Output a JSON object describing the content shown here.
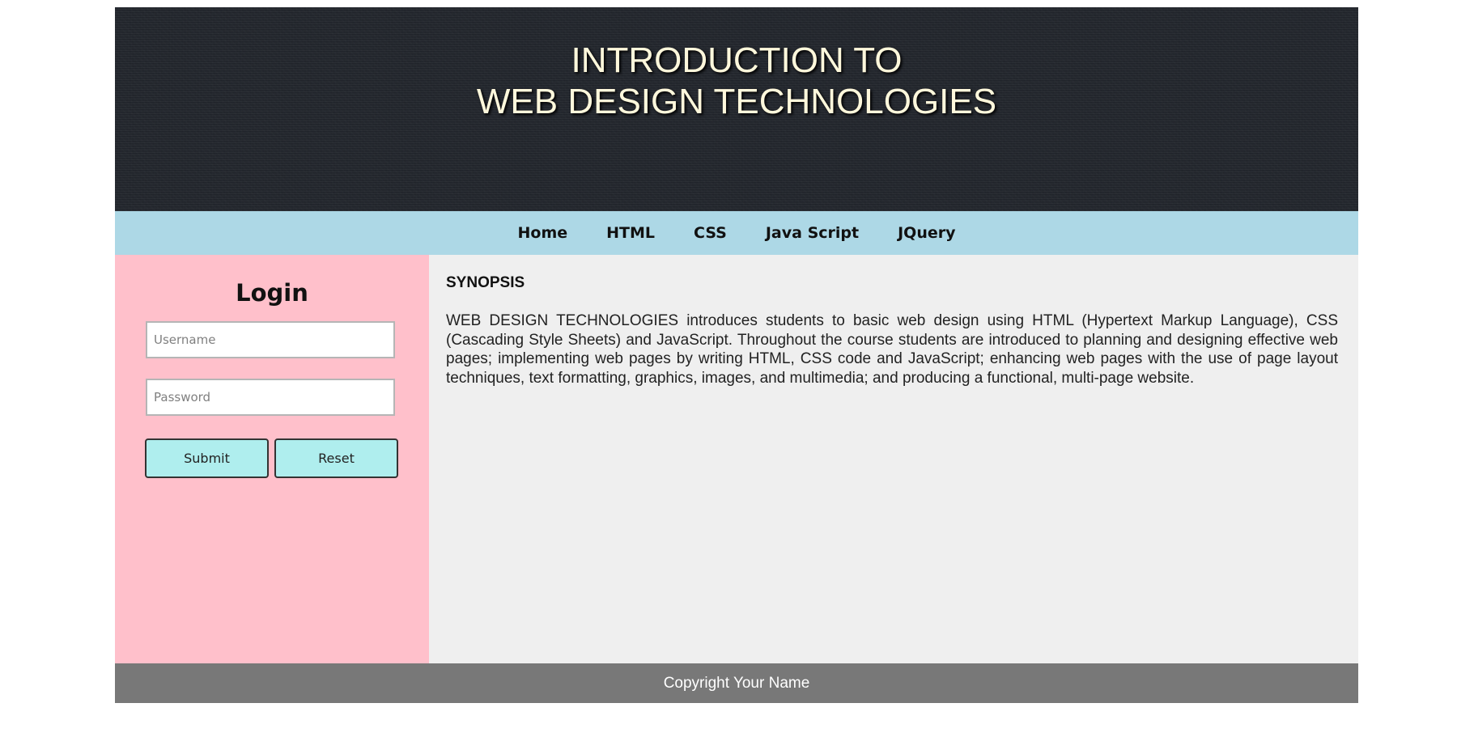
{
  "header": {
    "title_line1": "INTRODUCTION TO",
    "title_line2": "WEB DESIGN TECHNOLOGIES"
  },
  "nav": {
    "items": [
      {
        "label": "Home"
      },
      {
        "label": "HTML"
      },
      {
        "label": "CSS"
      },
      {
        "label": "Java Script"
      },
      {
        "label": "JQuery"
      }
    ]
  },
  "login": {
    "title": "Login",
    "username_placeholder": "Username",
    "username_value": "",
    "password_placeholder": "Password",
    "password_value": "",
    "submit_label": "Submit",
    "reset_label": "Reset"
  },
  "main": {
    "heading": "SYNOPSIS",
    "body": "WEB DESIGN TECHNOLOGIES introduces students to basic web design using HTML (Hypertext Markup Language), CSS (Cascading Style Sheets) and JavaScript. Throughout the course students are introduced to planning and designing effective web pages; implementing web pages by writing HTML, CSS code and JavaScript; enhancing web pages with the use of page layout techniques, text formatting, graphics, images, and multimedia; and producing a functional, multi-page website."
  },
  "footer": {
    "text": "Copyright Your Name"
  },
  "colors": {
    "header_bg": "#22262d",
    "header_text": "#fff8dc",
    "nav_bg": "#add8e6",
    "sidebar_bg": "#ffc0cb",
    "button_bg": "#afeeee",
    "content_bg": "#efefef",
    "footer_bg": "#787878"
  }
}
